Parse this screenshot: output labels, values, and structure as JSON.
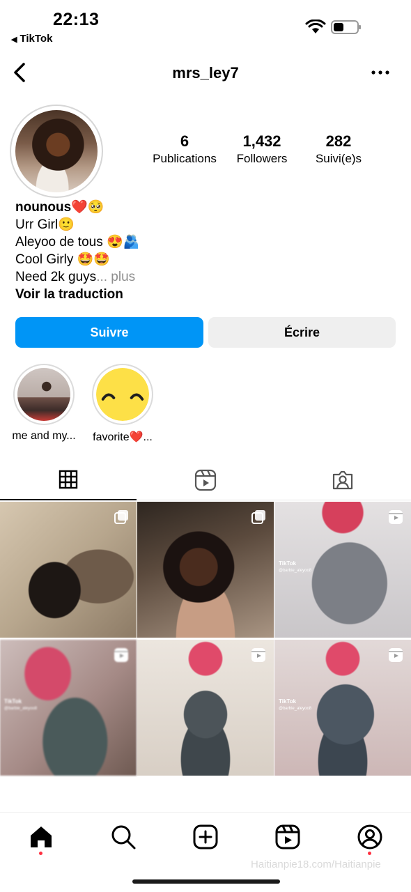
{
  "status_bar": {
    "time": "22:13",
    "back_app": "TikTok"
  },
  "header": {
    "username": "mrs_ley7"
  },
  "stats": [
    {
      "number": "6",
      "label": "Publications"
    },
    {
      "number": "1,432",
      "label": "Followers"
    },
    {
      "number": "282",
      "label": "Suivi(e)s"
    }
  ],
  "bio": {
    "name": "nounous❤️🥺",
    "lines": [
      "Urr Girl🙂",
      "Aleyoo de tous 😍🫂",
      "Cool Girly 🤩🤩"
    ],
    "truncated_line": "Need 2k guys",
    "more": "... plus",
    "translate": "Voir la traduction"
  },
  "buttons": {
    "follow": "Suivre",
    "write": "Écrire"
  },
  "highlights": [
    {
      "label": "me and my..."
    },
    {
      "label": "favorite❤️..."
    }
  ],
  "grid": {
    "tiktok_label": "TikTok",
    "tiktok_handle": "@barbie_aleyoo8"
  },
  "watermark": "Haitianpie18.com/Haitianpie",
  "colors": {
    "accent": "#0095f6",
    "notification": "#ff3040"
  }
}
